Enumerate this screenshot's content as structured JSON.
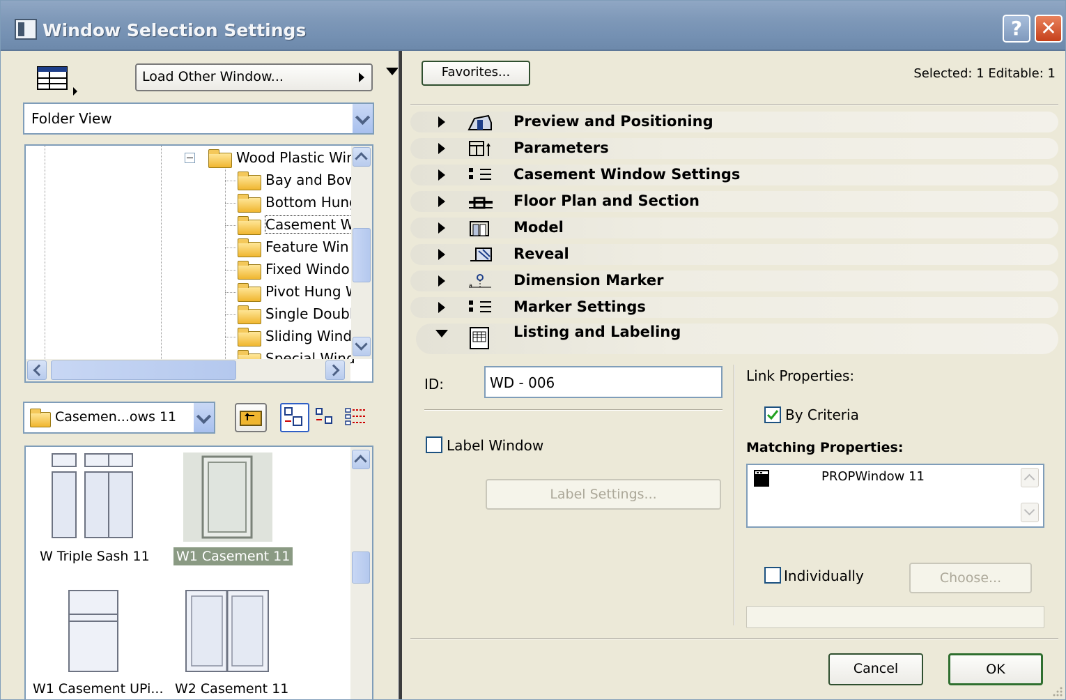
{
  "window": {
    "title": "Window Selection Settings",
    "help_label": "?",
    "close_label": "✕"
  },
  "left": {
    "load_other": "Load Other Window...",
    "view_mode": "Folder View",
    "tree": [
      {
        "label": "Wood Plastic Wir",
        "level": 0
      },
      {
        "label": "Bay and Bow",
        "level": 1
      },
      {
        "label": "Bottom Hung",
        "level": 1
      },
      {
        "label": "Casement W",
        "level": 1
      },
      {
        "label": "Feature Win",
        "level": 1
      },
      {
        "label": "Fixed Windo",
        "level": 1
      },
      {
        "label": "Pivot Hung W",
        "level": 1
      },
      {
        "label": "Single Doubl",
        "level": 1
      },
      {
        "label": "Sliding Windc",
        "level": 1
      },
      {
        "label": "Special Wind",
        "level": 1
      }
    ],
    "folder_select": "Casemen...ows 11",
    "thumbnails": [
      {
        "label": "W Triple Sash 11"
      },
      {
        "label": "W1 Casement 11"
      },
      {
        "label": "W1 Casement UPi..."
      },
      {
        "label": "W2 Casement 11"
      }
    ]
  },
  "right": {
    "favorites": "Favorites...",
    "selected_info": "Selected: 1 Editable: 1",
    "sections": [
      {
        "title": "Preview and Positioning",
        "icon": "preview-icon"
      },
      {
        "title": "Parameters",
        "icon": "parameters-icon"
      },
      {
        "title": "Casement Window Settings",
        "icon": "settings-list-icon"
      },
      {
        "title": "Floor Plan and Section",
        "icon": "floor-plan-icon"
      },
      {
        "title": "Model",
        "icon": "model-icon"
      },
      {
        "title": "Reveal",
        "icon": "reveal-icon"
      },
      {
        "title": "Dimension Marker",
        "icon": "dimension-marker-icon"
      },
      {
        "title": "Marker Settings",
        "icon": "marker-settings-icon"
      },
      {
        "title": "Listing and Labeling",
        "icon": "listing-icon"
      }
    ],
    "listing": {
      "id_label": "ID:",
      "id_value": "WD - 006",
      "label_window": "Label Window",
      "label_settings": "Label Settings...",
      "link_properties": "Link Properties:",
      "by_criteria": "By Criteria",
      "matching_properties": "Matching Properties:",
      "matching_item": "PROPWindow 11",
      "individually": "Individually",
      "choose": "Choose..."
    },
    "cancel": "Cancel",
    "ok": "OK"
  },
  "colors": {
    "title_bar": "#7e98b8",
    "face": "#ece9d8",
    "close": "#c6411c",
    "field_border": "#7f9db9"
  }
}
